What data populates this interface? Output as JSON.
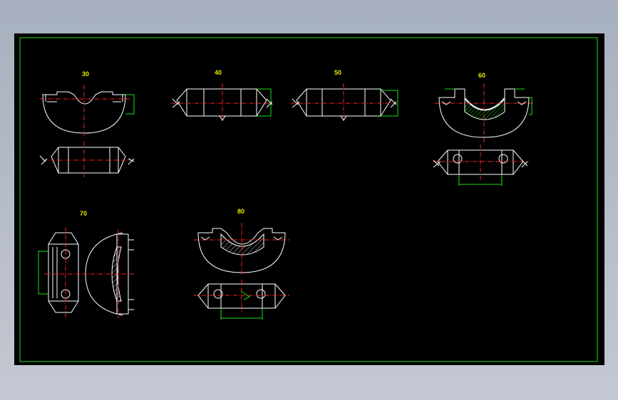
{
  "drawing": {
    "views": [
      {
        "id": "v30",
        "label": "30"
      },
      {
        "id": "v40",
        "label": "40"
      },
      {
        "id": "v50",
        "label": "50"
      },
      {
        "id": "v60",
        "label": "60"
      },
      {
        "id": "v70",
        "label": "70"
      },
      {
        "id": "v80",
        "label": "80"
      }
    ]
  },
  "colors": {
    "background": "#000000",
    "frame": "#18e018",
    "outline": "#ffffff",
    "centerline": "#ff2020",
    "label": "#e8e800"
  }
}
